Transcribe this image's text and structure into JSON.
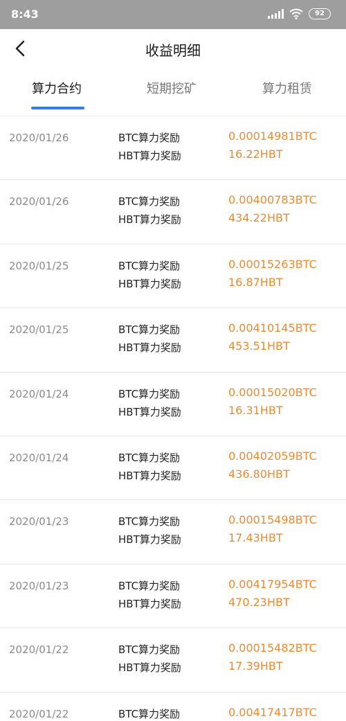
{
  "status_bar": {
    "time": "8:43",
    "battery": "92"
  },
  "nav": {
    "title": "收益明细"
  },
  "tabs": [
    {
      "label": "算力合约",
      "active": true
    },
    {
      "label": "短期挖矿",
      "active": false
    },
    {
      "label": "算力租赁",
      "active": false
    }
  ],
  "labels": {
    "btc": "BTC算力奖励",
    "hbt": "HBT算力奖励"
  },
  "colors": {
    "accent": "#2f7ee6",
    "amount": "#ee8a2e",
    "status_bar": "#9e9e9e"
  },
  "records": [
    {
      "date": "2020/01/26",
      "btc": "0.00014981BTC",
      "hbt": "16.22HBT"
    },
    {
      "date": "2020/01/26",
      "btc": "0.00400783BTC",
      "hbt": "434.22HBT"
    },
    {
      "date": "2020/01/25",
      "btc": "0.00015263BTC",
      "hbt": "16.87HBT"
    },
    {
      "date": "2020/01/25",
      "btc": "0.00410145BTC",
      "hbt": "453.51HBT"
    },
    {
      "date": "2020/01/24",
      "btc": "0.00015020BTC",
      "hbt": "16.31HBT"
    },
    {
      "date": "2020/01/24",
      "btc": "0.00402059BTC",
      "hbt": "436.80HBT"
    },
    {
      "date": "2020/01/23",
      "btc": "0.00015498BTC",
      "hbt": "17.43HBT"
    },
    {
      "date": "2020/01/23",
      "btc": "0.00417954BTC",
      "hbt": "470.23HBT"
    },
    {
      "date": "2020/01/22",
      "btc": "0.00015482BTC",
      "hbt": "17.39HBT"
    },
    {
      "date": "2020/01/22",
      "btc": "0.00417417BTC",
      "hbt": ""
    }
  ]
}
